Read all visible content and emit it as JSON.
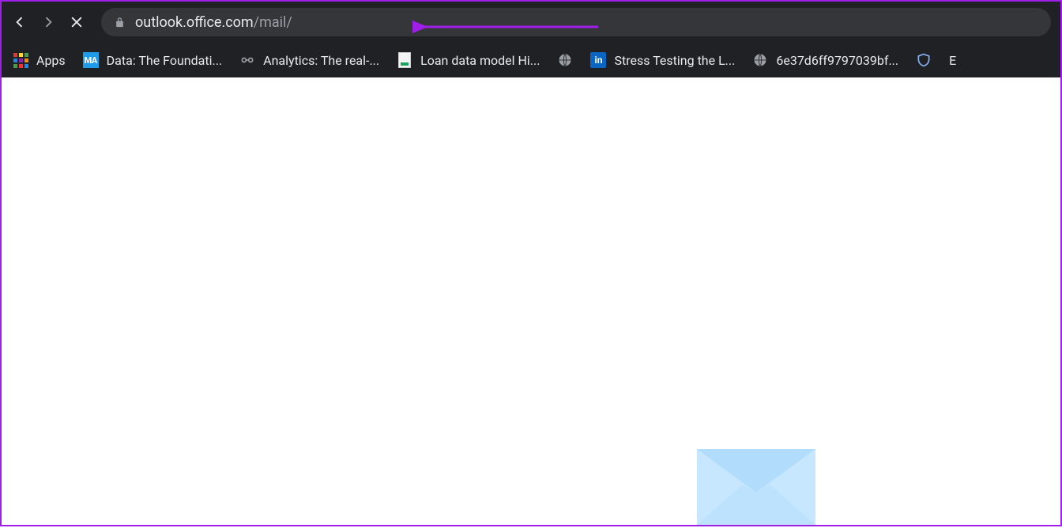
{
  "url": {
    "host": "outlook.office.com",
    "path": "/mail/"
  },
  "bookmarks": {
    "apps_label": "Apps",
    "items": [
      {
        "label": "Data: The Foundati...",
        "icon": "ma"
      },
      {
        "label": "Analytics: The real-...",
        "icon": "analytics"
      },
      {
        "label": "Loan data model Hi...",
        "icon": "doc"
      },
      {
        "label": "",
        "icon": "globe"
      },
      {
        "label": "Stress Testing the L...",
        "icon": "in"
      },
      {
        "label": "6e37d6ff9797039bf...",
        "icon": "globe"
      },
      {
        "label": "",
        "icon": "shield"
      },
      {
        "label": "E",
        "icon": "none"
      }
    ]
  }
}
